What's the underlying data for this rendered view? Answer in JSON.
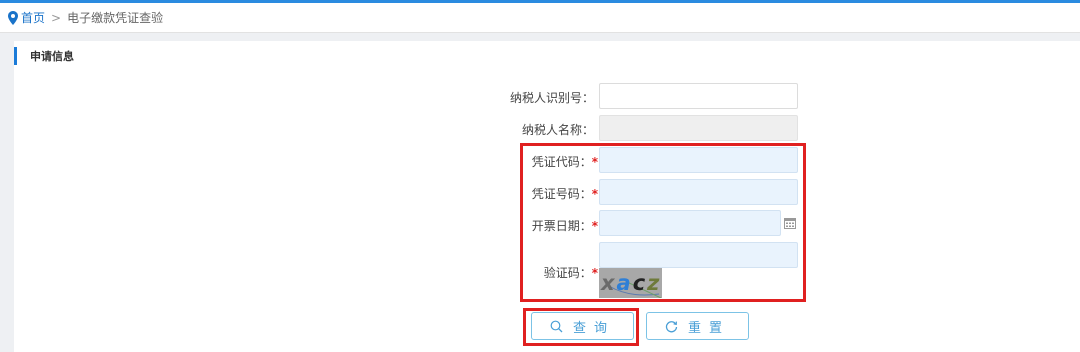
{
  "breadcrumb": {
    "home": "首页",
    "separator": ">",
    "current": "电子缴款凭证查验"
  },
  "section": {
    "title": "申请信息"
  },
  "form": {
    "taxpayer_id": {
      "label": "纳税人识别号：",
      "value": ""
    },
    "taxpayer_name": {
      "label": "纳税人名称：",
      "value": ""
    },
    "voucher_code": {
      "label": "凭证代码",
      "suffix": "：",
      "required_mark": "*",
      "value": ""
    },
    "voucher_number": {
      "label": "凭证号码",
      "suffix": "：",
      "required_mark": "*",
      "value": ""
    },
    "issue_date": {
      "label": "开票日期",
      "suffix": "：",
      "required_mark": "*",
      "value": ""
    },
    "captcha": {
      "label": "验证码",
      "suffix": "：",
      "required_mark": "*",
      "value": "",
      "image_text": "xacz"
    }
  },
  "buttons": {
    "query_label": "查询",
    "reset_label": "重置"
  },
  "colors": {
    "accent": "#1a7bd8",
    "highlight": "#e02020",
    "required_bg": "#e9f3fd",
    "button_text": "#4a9fd6"
  },
  "icons": {
    "location": "map-pin-icon",
    "calendar": "calendar-icon",
    "search": "search-icon",
    "refresh": "refresh-icon"
  }
}
